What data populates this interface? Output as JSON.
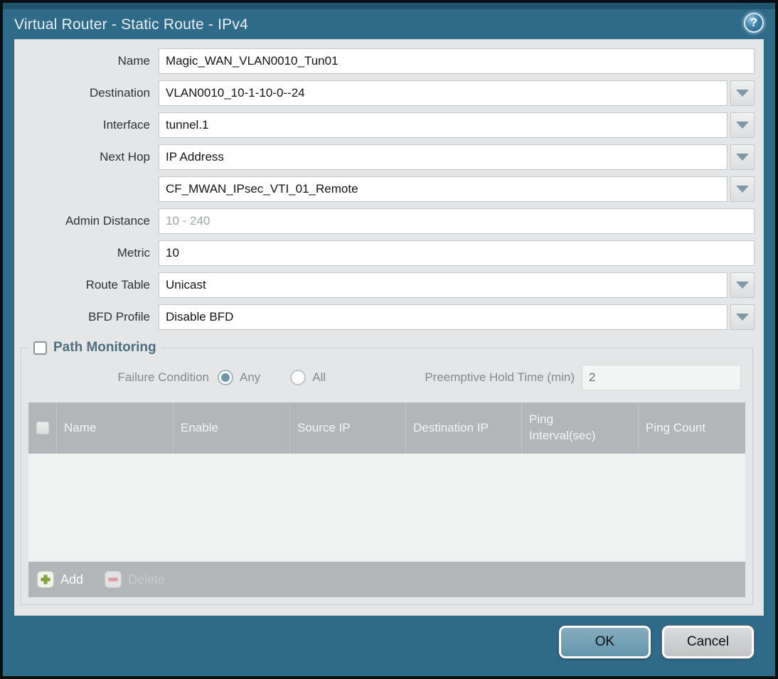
{
  "dialog": {
    "title": "Virtual Router - Static Route - IPv4",
    "help_icon_glyph": "?"
  },
  "form": {
    "name": {
      "label": "Name",
      "value": "Magic_WAN_VLAN0010_Tun01"
    },
    "destination": {
      "label": "Destination",
      "value": "VLAN0010_10-1-10-0--24"
    },
    "interface": {
      "label": "Interface",
      "value": "tunnel.1"
    },
    "next_hop": {
      "label": "Next Hop",
      "value": "IP Address"
    },
    "next_hop_address": {
      "value": "CF_MWAN_IPsec_VTI_01_Remote"
    },
    "admin_distance": {
      "label": "Admin Distance",
      "placeholder": "10 - 240"
    },
    "metric": {
      "label": "Metric",
      "value": "10"
    },
    "route_table": {
      "label": "Route Table",
      "value": "Unicast"
    },
    "bfd_profile": {
      "label": "BFD Profile",
      "value": "Disable BFD"
    }
  },
  "path_monitoring": {
    "title": "Path Monitoring",
    "enabled": false,
    "failure_condition": {
      "label": "Failure Condition",
      "option_any": "Any",
      "option_all": "All",
      "selected": "Any"
    },
    "preemptive_hold_time": {
      "label": "Preemptive Hold Time (min)",
      "value": "2"
    },
    "table": {
      "columns": [
        "Name",
        "Enable",
        "Source IP",
        "Destination IP",
        "Ping Interval(sec)",
        "Ping Count"
      ],
      "rows": []
    },
    "toolbar": {
      "add": "Add",
      "delete": "Delete"
    }
  },
  "footer": {
    "ok": "OK",
    "cancel": "Cancel"
  },
  "colors": {
    "titlebar_teal": "#2e6b88",
    "content_gray": "#e5e6e7",
    "table_header_gray": "#b2b6b9",
    "ok_button_teal": "#6f9fb4",
    "add_icon_green": "#7da23f",
    "delete_icon_red": "#d98f96"
  }
}
